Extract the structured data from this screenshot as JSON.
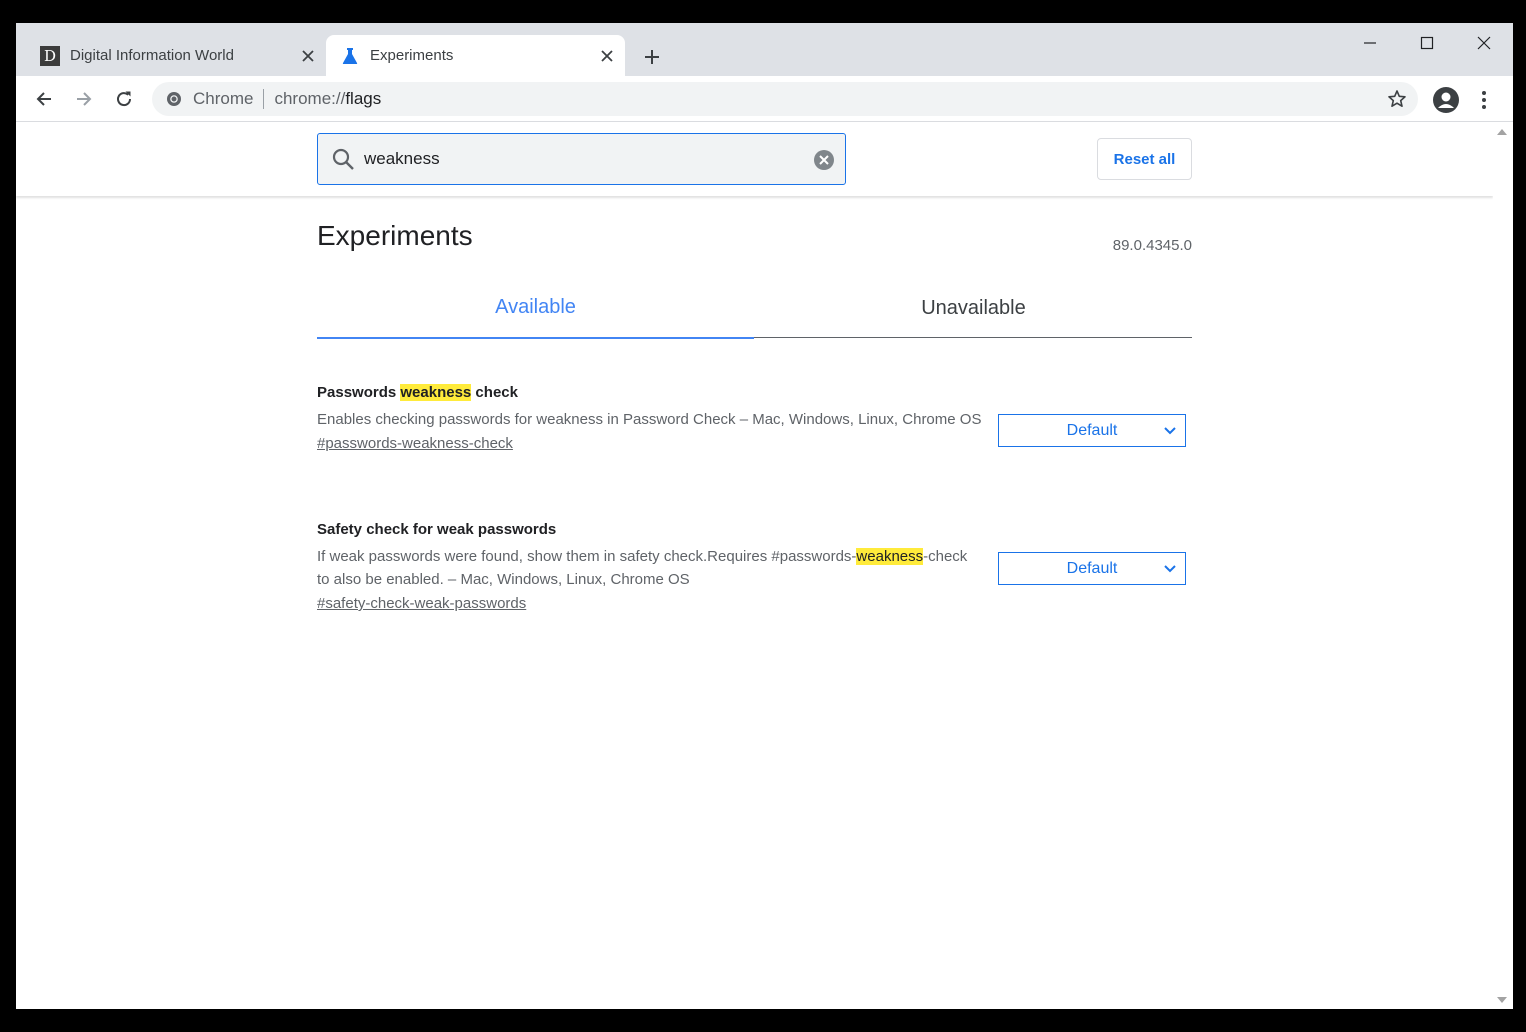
{
  "tabs": [
    {
      "title": "Digital Information World",
      "favicon_letter": "D",
      "active": false
    },
    {
      "title": "Experiments",
      "favicon": "flask-icon",
      "active": true
    }
  ],
  "toolbar": {
    "chip_label": "Chrome",
    "url_scheme": "chrome://",
    "url_path": "flags"
  },
  "flags_page": {
    "search_value": "weakness",
    "reset_all_label": "Reset all",
    "title": "Experiments",
    "version": "89.0.4345.0",
    "tabs": {
      "available": "Available",
      "unavailable": "Unavailable"
    },
    "flags": [
      {
        "name_before": "Passwords ",
        "name_highlight": "weakness",
        "name_after": " check",
        "description": "Enables checking passwords for weakness in Password Check – Mac, Windows, Linux, Chrome OS",
        "link": "#passwords-weakness-check",
        "selected": "Default"
      },
      {
        "name": "Safety check for weak passwords",
        "desc_before": "If weak passwords were found, show them in safety check.Requires #passwords-",
        "desc_highlight": "weakness",
        "desc_after": "-check to also be enabled. – Mac, Windows, Linux, Chrome OS",
        "link": "#safety-check-weak-passwords",
        "selected": "Default"
      }
    ]
  },
  "colors": {
    "accent": "#1a73e8",
    "tab_active": "#4285f4",
    "highlight": "#ffeb3b",
    "tabstrip": "#dee1e6"
  }
}
